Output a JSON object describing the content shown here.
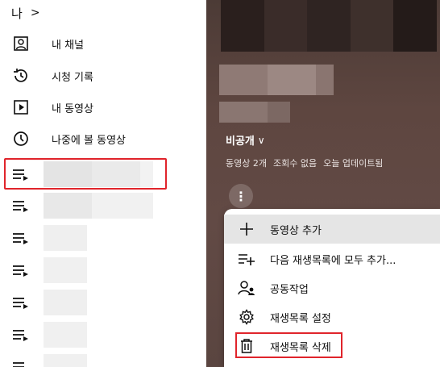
{
  "sidebar": {
    "you_label": "나",
    "items": [
      {
        "label": "내 채널",
        "icon": "user-icon"
      },
      {
        "label": "시청 기록",
        "icon": "history-icon"
      },
      {
        "label": "내 동영상",
        "icon": "play-icon"
      },
      {
        "label": "나중에 볼 동영상",
        "icon": "clock-icon"
      }
    ],
    "playlist_icon": "playlist-icon"
  },
  "playlist": {
    "privacy": "비공개",
    "video_count": "동영상 2개",
    "views": "조회수 없음",
    "updated": "오늘 업데이트됨"
  },
  "menu": {
    "items": [
      {
        "label": "동영상 추가",
        "icon": "plus-icon"
      },
      {
        "label": "다음 재생목록에 모두 추가...",
        "icon": "playlist-add-icon"
      },
      {
        "label": "공동작업",
        "icon": "collaborate-icon"
      },
      {
        "label": "재생목록 설정",
        "icon": "gear-icon"
      },
      {
        "label": "재생목록 삭제",
        "icon": "trash-icon"
      }
    ]
  },
  "colors": {
    "highlight": "#e0242b",
    "panel_bg": "#5e4640"
  }
}
